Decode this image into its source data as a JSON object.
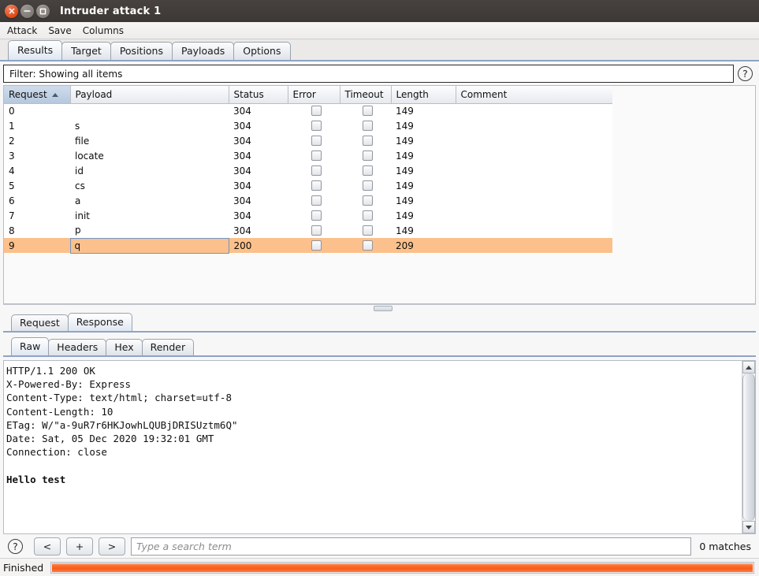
{
  "window": {
    "title": "Intruder attack 1",
    "buttons": {
      "close": "close-button",
      "minimize": "minimize-button",
      "maximize": "maximize-button"
    }
  },
  "menubar": {
    "items": [
      "Attack",
      "Save",
      "Columns"
    ]
  },
  "main_tabs": {
    "items": [
      "Results",
      "Target",
      "Positions",
      "Payloads",
      "Options"
    ],
    "active": "Results"
  },
  "filter": {
    "text": "Filter: Showing all items",
    "help_icon": "?"
  },
  "results_table": {
    "columns": [
      "Request",
      "Payload",
      "Status",
      "Error",
      "Timeout",
      "Length",
      "Comment"
    ],
    "sorted_column": "Request",
    "sort_direction": "ascending",
    "selected_row_index": 9,
    "selected_row_color": "#fbc08b",
    "rows": [
      {
        "request": "0",
        "payload": "",
        "status": "304",
        "error": false,
        "timeout": false,
        "length": "149",
        "comment": ""
      },
      {
        "request": "1",
        "payload": "s",
        "status": "304",
        "error": false,
        "timeout": false,
        "length": "149",
        "comment": ""
      },
      {
        "request": "2",
        "payload": "file",
        "status": "304",
        "error": false,
        "timeout": false,
        "length": "149",
        "comment": ""
      },
      {
        "request": "3",
        "payload": "locate",
        "status": "304",
        "error": false,
        "timeout": false,
        "length": "149",
        "comment": ""
      },
      {
        "request": "4",
        "payload": "id",
        "status": "304",
        "error": false,
        "timeout": false,
        "length": "149",
        "comment": ""
      },
      {
        "request": "5",
        "payload": "cs",
        "status": "304",
        "error": false,
        "timeout": false,
        "length": "149",
        "comment": ""
      },
      {
        "request": "6",
        "payload": "a",
        "status": "304",
        "error": false,
        "timeout": false,
        "length": "149",
        "comment": ""
      },
      {
        "request": "7",
        "payload": "init",
        "status": "304",
        "error": false,
        "timeout": false,
        "length": "149",
        "comment": ""
      },
      {
        "request": "8",
        "payload": "p",
        "status": "304",
        "error": false,
        "timeout": false,
        "length": "149",
        "comment": ""
      },
      {
        "request": "9",
        "payload": "q",
        "status": "200",
        "error": false,
        "timeout": false,
        "length": "209",
        "comment": ""
      }
    ]
  },
  "message_tabs": {
    "items": [
      "Request",
      "Response"
    ],
    "active": "Response"
  },
  "view_tabs": {
    "items": [
      "Raw",
      "Headers",
      "Hex",
      "Render"
    ],
    "active": "Raw"
  },
  "response": {
    "headers_text": "HTTP/1.1 200 OK\nX-Powered-By: Express\nContent-Type: text/html; charset=utf-8\nContent-Length: 10\nETag: W/\"a-9uR7r6HKJowhLQUBjDRISUztm6Q\"\nDate: Sat, 05 Dec 2020 19:32:01 GMT\nConnection: close",
    "body_text": "Hello test"
  },
  "search": {
    "help_icon": "?",
    "prev_label": "<",
    "add_label": "+",
    "next_label": ">",
    "placeholder": "Type a search term",
    "value": "",
    "matches_label": "0 matches"
  },
  "statusbar": {
    "status": "Finished",
    "progress_percent": 100,
    "progress_color": "#f75c18"
  }
}
